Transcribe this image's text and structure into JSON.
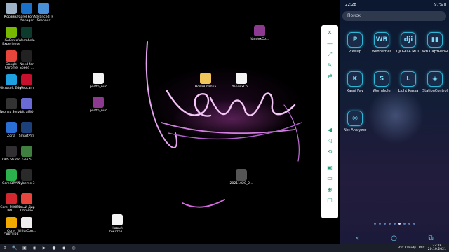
{
  "desktop": {
    "icons_left": [
      {
        "label": "Корзина",
        "icon": "recycle-bin-icon",
        "color": "#9fb3c8"
      },
      {
        "label": "GeForce Experience",
        "icon": "nvidia-icon",
        "color": "#76b900"
      },
      {
        "label": "Google Chrome",
        "icon": "chrome-icon",
        "color": "#e8453c"
      },
      {
        "label": "Microsoft Edge",
        "icon": "edge-icon",
        "color": "#1fa0e0"
      },
      {
        "label": "Twonky Server",
        "icon": "twonky-icon",
        "color": "#333333"
      },
      {
        "label": "Zona",
        "icon": "zona-icon",
        "color": "#2a6fd6"
      },
      {
        "label": "OBS Studio",
        "icon": "obs-icon",
        "color": "#302e31"
      },
      {
        "label": "CorelDRAW",
        "icon": "coreldraw-icon",
        "color": "#2bb24c"
      },
      {
        "label": "Corel PHOTO-PAI...",
        "icon": "corel-photopaint-icon",
        "color": "#d3262e"
      },
      {
        "label": "Corel CAPTURE",
        "icon": "corel-capture-icon",
        "color": "#f2a900"
      }
    ],
    "icons_col2": [
      {
        "label": "Corel Font Manager",
        "icon": "font-manager-icon",
        "color": "#1a6fc9"
      },
      {
        "label": "Wormhole",
        "icon": "wormhole-icon",
        "color": "#0c3b2e"
      },
      {
        "label": "Need for Speed ...",
        "icon": "nfs-icon",
        "color": "#222222"
      },
      {
        "label": "Webcam",
        "icon": "webcam-47-icon",
        "color": "#c8102e"
      },
      {
        "label": "UltraISO",
        "icon": "ultraiso-icon",
        "color": "#6b6bd6"
      },
      {
        "label": "SmartPSS",
        "icon": "smartpss-icon",
        "color": "#1d3f7a"
      },
      {
        "label": "GTA 5",
        "icon": "gta-icon",
        "color": "#3f7f3f"
      },
      {
        "label": "Sybeme 3",
        "icon": "sybeme-icon",
        "color": "#2a2a2a"
      },
      {
        "label": "Новый Дир - Chrome",
        "icon": "chrome-icon",
        "color": "#e8453c"
      },
      {
        "label": "WhiteCon...",
        "icon": "file-icon",
        "color": "#eeeeee"
      }
    ],
    "icons_col3": [
      {
        "label": "Advanced IP Scanner",
        "icon": "ip-scanner-icon",
        "color": "#4a90d9"
      }
    ],
    "scattered": [
      {
        "label": "portfo_nuc",
        "icon": "file-icon"
      },
      {
        "label": "portfo_nuc",
        "icon": "rar-icon"
      },
      {
        "label": "YandexCo...",
        "icon": "rar-icon"
      },
      {
        "label": "Новая папка",
        "icon": "folder-icon"
      },
      {
        "label": "YandexCo...",
        "icon": "file-icon"
      },
      {
        "label": "20211020_2...",
        "icon": "image-file-icon"
      },
      {
        "label": "Новый текстов...",
        "icon": "file-icon"
      }
    ]
  },
  "toolbar": {
    "buttons": [
      "close-icon",
      "minimize-icon",
      "fullscreen-icon",
      "pin-icon",
      "share-icon",
      "volume-icon",
      "volume-down-icon",
      "rotate-icon",
      "screenshot-icon",
      "phone-screen-icon",
      "camera-icon",
      "folder-icon",
      "more-icon"
    ],
    "glyphs": [
      "✕",
      "—",
      "⤢",
      "✎",
      "⇄",
      "◀",
      "◁",
      "⟲",
      "▣",
      "▭",
      "◉",
      "▢",
      "⋯"
    ]
  },
  "phone": {
    "time": "22:28",
    "status_right": "97% ▮",
    "search_placeholder": "Поиск",
    "apps": [
      {
        "label": "Pixelup",
        "glyph": "P"
      },
      {
        "label": "Wildberries",
        "glyph": "WB"
      },
      {
        "label": "DJI GO 4 MOD",
        "glyph": "dji"
      },
      {
        "label": "WB Партнёры",
        "glyph": "▮▮"
      },
      {
        "label": "Kaspi Pay",
        "glyph": "K"
      },
      {
        "label": "Wormhole",
        "glyph": "S"
      },
      {
        "label": "Light Kassa",
        "glyph": "L"
      },
      {
        "label": "StationControl",
        "glyph": "◈"
      },
      {
        "label": "Net Analyzer",
        "glyph": "◎"
      }
    ],
    "nav": [
      "«",
      "○",
      "⧉"
    ]
  },
  "taskbar": {
    "items": [
      "⊞",
      "🔍",
      "▣",
      "◉",
      "▶",
      "●",
      "◆",
      "◎"
    ],
    "weather": "3°C Cloudy",
    "lang": "РУС",
    "clock_time": "22:28",
    "clock_date": "20.10.2021"
  }
}
